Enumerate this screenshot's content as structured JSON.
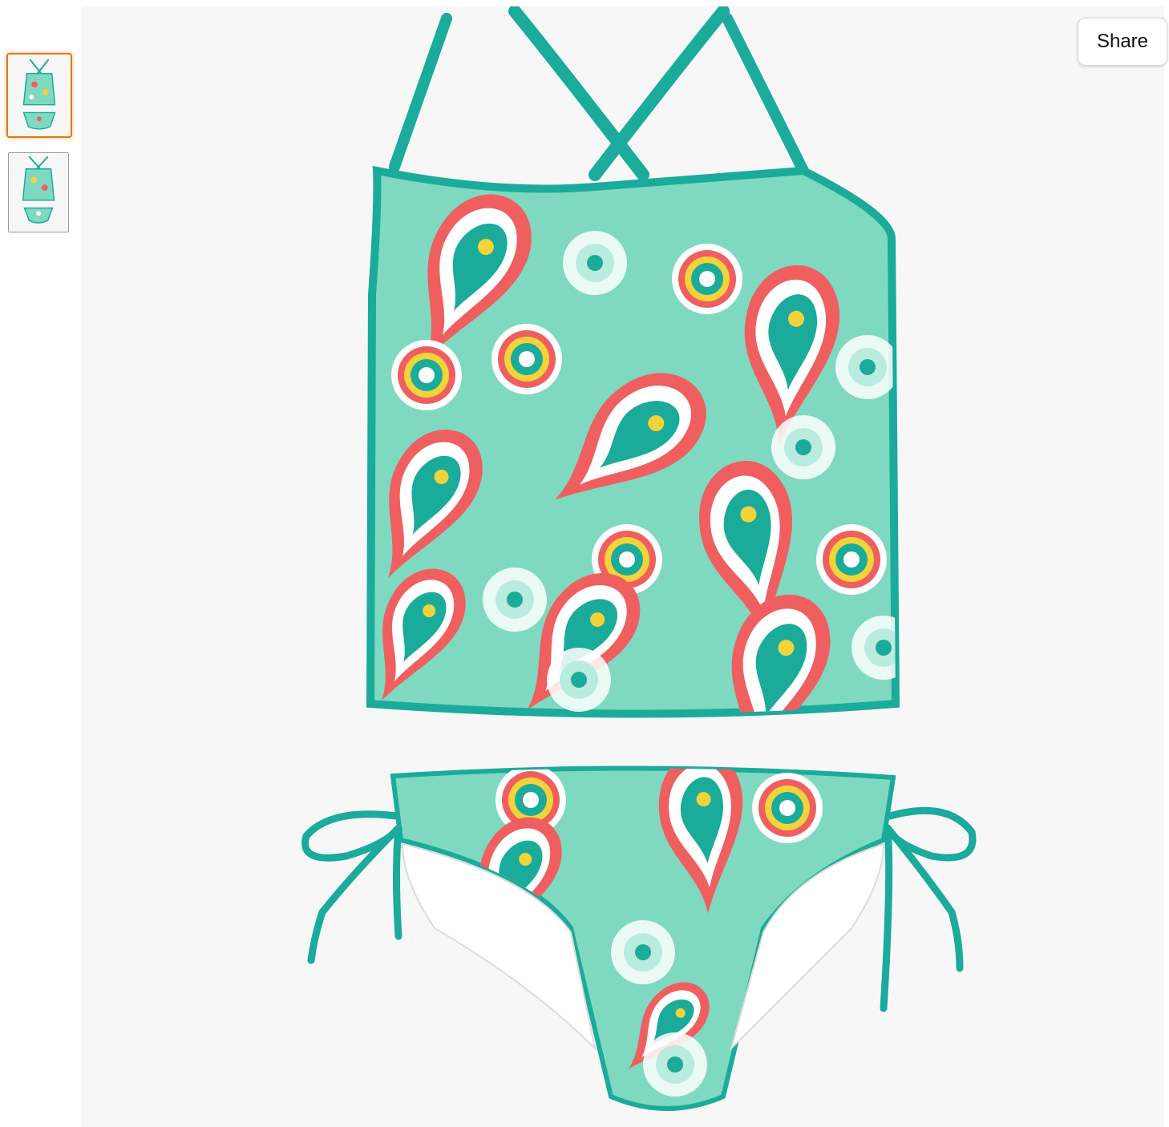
{
  "share": {
    "label": "Share"
  },
  "thumbnails": [
    {
      "name": "tankini-front-view",
      "selected": true
    },
    {
      "name": "tankini-alternate-view",
      "selected": false
    }
  ],
  "colors": {
    "accent_selected": "#e77600",
    "fabric_mint": "#7fd9c1",
    "trim_teal": "#1aab9b",
    "paisley_coral": "#ef5f5f",
    "paisley_yellow": "#f2d33a",
    "viewer_background": "#f7f7f7"
  }
}
